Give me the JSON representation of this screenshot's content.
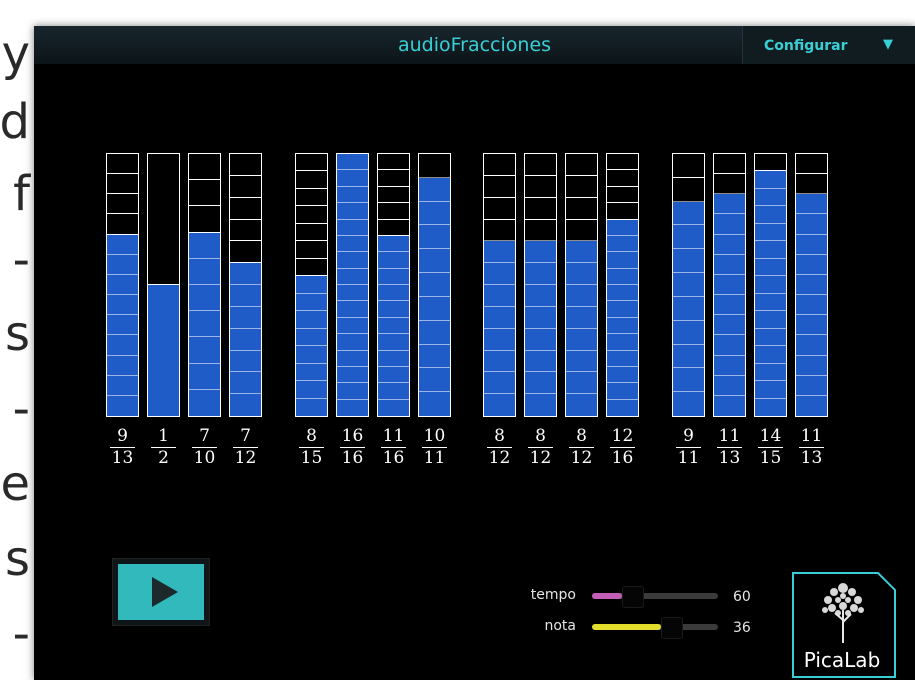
{
  "page": {
    "left_text_fragments": [
      "y",
      "d",
      "f",
      "-",
      "s",
      "-",
      "e",
      "s",
      "-"
    ]
  },
  "app": {
    "title": "audioFracciones",
    "config_label": "Configurar",
    "config_arrow_icon": "triangle-down-icon",
    "colors": {
      "accent": "#38cfd6",
      "bar_fill": "#1f5cc7",
      "bar_border": "#ffffff",
      "play_button": "#32b9bc",
      "tempo_slider": "#c45fb8",
      "nota_slider": "#e3dd2b"
    }
  },
  "fractions": [
    {
      "group": 1,
      "numerator": "9",
      "denominator": "13",
      "value": 0.6923
    },
    {
      "group": 1,
      "numerator": "1",
      "denominator": "2",
      "value": 0.5
    },
    {
      "group": 1,
      "numerator": "7",
      "denominator": "10",
      "value": 0.7
    },
    {
      "group": 1,
      "numerator": "7",
      "denominator": "12",
      "value": 0.5833
    },
    {
      "group": 2,
      "numerator": "8",
      "denominator": "15",
      "value": 0.5333
    },
    {
      "group": 2,
      "numerator": "16",
      "denominator": "16",
      "value": 1.0
    },
    {
      "group": 2,
      "numerator": "11",
      "denominator": "16",
      "value": 0.6875
    },
    {
      "group": 2,
      "numerator": "10",
      "denominator": "11",
      "value": 0.9091
    },
    {
      "group": 3,
      "numerator": "8",
      "denominator": "12",
      "value": 0.6667
    },
    {
      "group": 3,
      "numerator": "8",
      "denominator": "12",
      "value": 0.6667
    },
    {
      "group": 3,
      "numerator": "8",
      "denominator": "12",
      "value": 0.6667
    },
    {
      "group": 3,
      "numerator": "12",
      "denominator": "16",
      "value": 0.75
    },
    {
      "group": 4,
      "numerator": "9",
      "denominator": "11",
      "value": 0.8182
    },
    {
      "group": 4,
      "numerator": "11",
      "denominator": "13",
      "value": 0.8462
    },
    {
      "group": 4,
      "numerator": "14",
      "denominator": "15",
      "value": 0.9333
    },
    {
      "group": 4,
      "numerator": "11",
      "denominator": "13",
      "value": 0.8462
    }
  ],
  "controls": {
    "play_icon": "play-icon",
    "tempo": {
      "label": "tempo",
      "value": "60",
      "level": 0.24
    },
    "nota": {
      "label": "nota",
      "value": "36",
      "level": 0.55
    }
  },
  "logo": {
    "text": "PicaLab",
    "icon": "tree-icon"
  }
}
